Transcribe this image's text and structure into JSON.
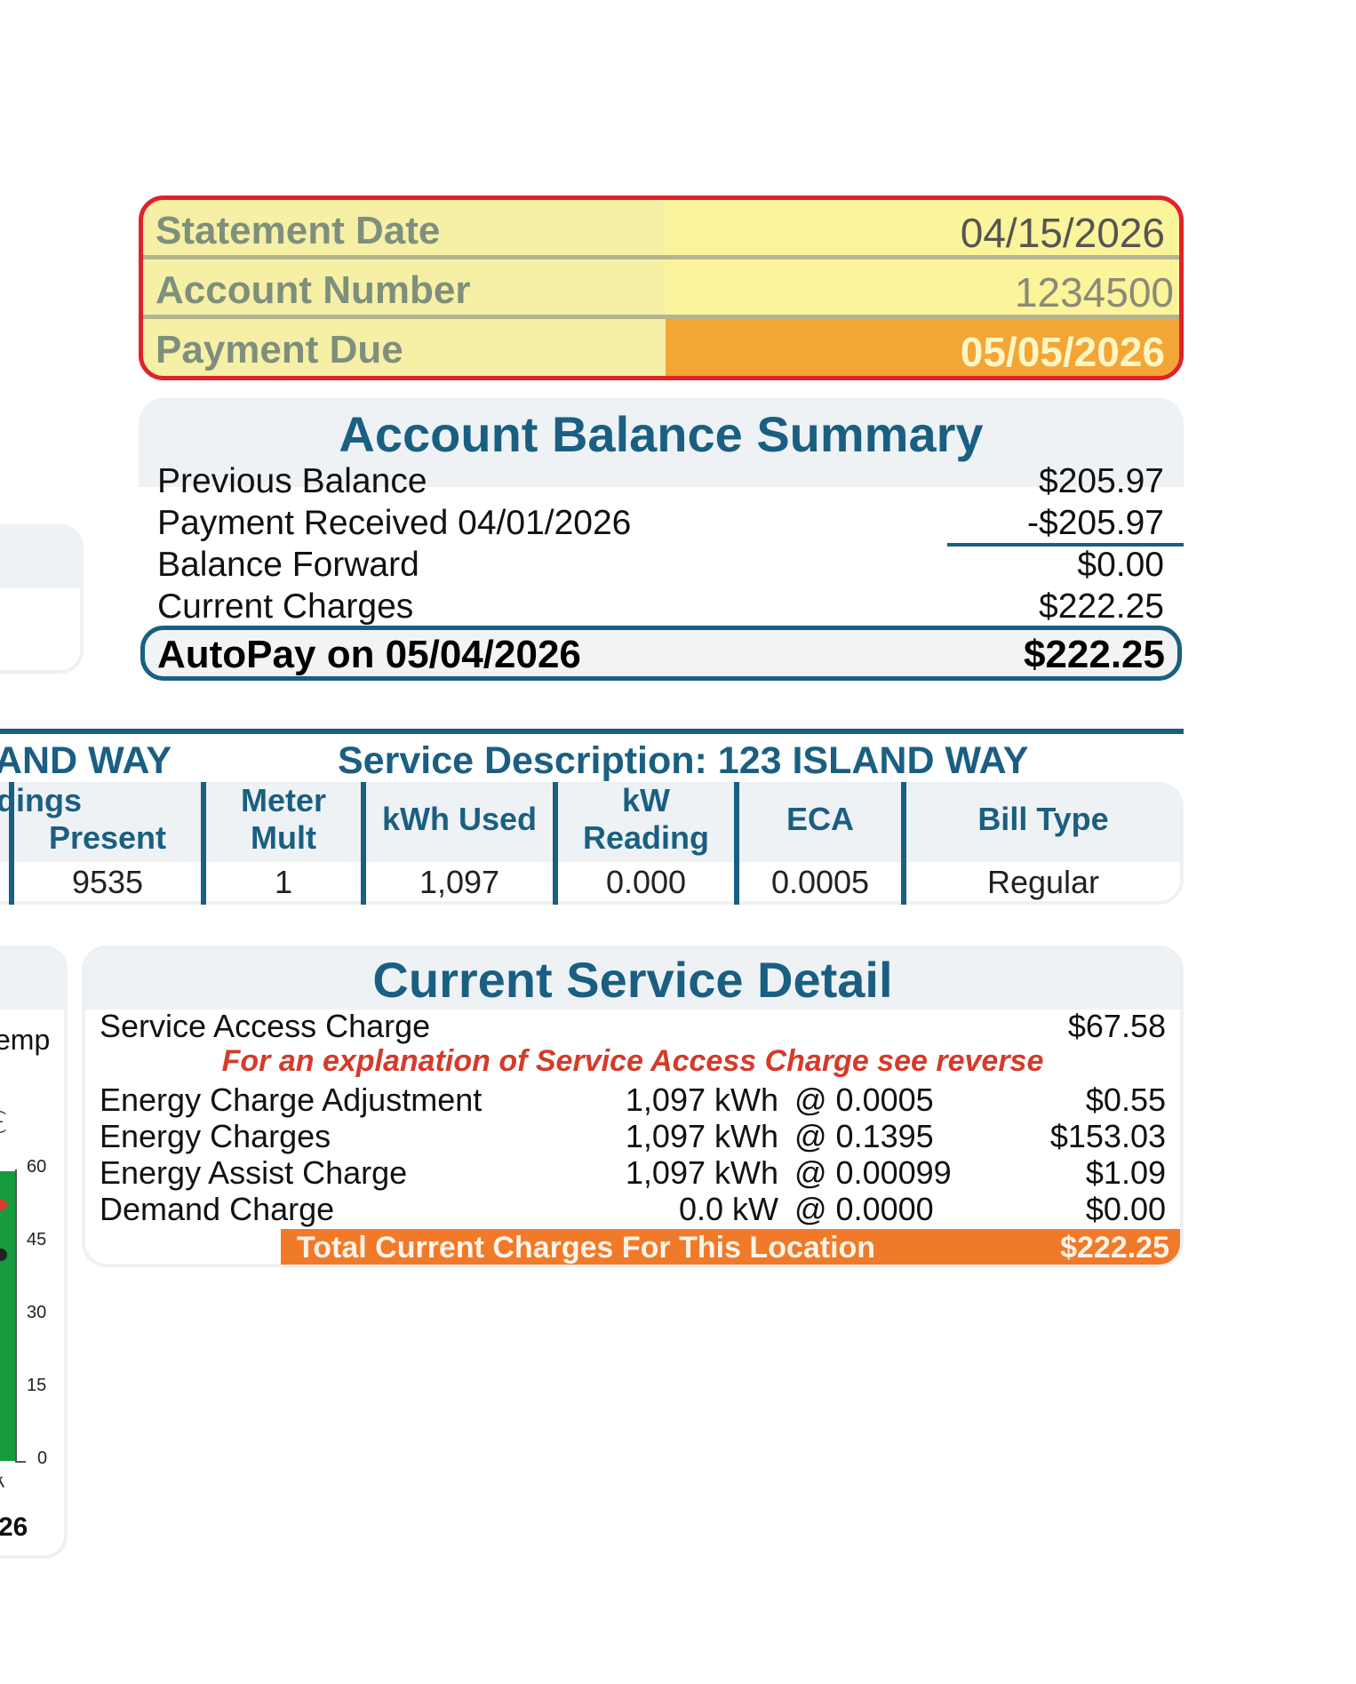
{
  "statement_box": {
    "rows": [
      {
        "label": "Statement Date",
        "value": "04/15/2026"
      },
      {
        "label": "Account Number",
        "value": "1234500"
      },
      {
        "label": "Payment Due",
        "value": "05/05/2026"
      }
    ],
    "colors": {
      "border": "#e0222b",
      "label_bg": "#f5f0a6",
      "due_bg": "#f3a536"
    }
  },
  "balance_summary": {
    "title": "Account Balance Summary",
    "rows": [
      {
        "label": "Previous Balance",
        "value": "$205.97"
      },
      {
        "label": "Payment Received 04/01/2026",
        "value": "-$205.97"
      },
      {
        "label": "Balance Forward",
        "value": "$0.00"
      },
      {
        "label": "Current Charges",
        "value": "$222.25"
      }
    ],
    "autopay": {
      "label": "AutoPay on 05/04/2026",
      "value": "$222.25"
    }
  },
  "service_description": {
    "left_fragment": "AND WAY",
    "title": "Service Description: 123 ISLAND WAY",
    "readings_fragment": "dings",
    "present_label": "Present",
    "columns": [
      "Meter Mult",
      "kWh Used",
      "kW Reading",
      "ECA",
      "Bill Type"
    ],
    "row": {
      "present": "9535",
      "meter_mult": "1",
      "kwh_used": "1,097",
      "kw_reading": "0.000",
      "eca": "0.0005",
      "bill_type": "Regular"
    }
  },
  "usage_chart_fragment": {
    "header_fragment": "emp",
    "axis_label_fragment": "(°F)",
    "y_ticks": [
      "60",
      "45",
      "30",
      "15",
      "0"
    ],
    "year_fragment": "26",
    "x_fragment": "r",
    "bar_color": "#169a3e"
  },
  "service_detail": {
    "title": "Current Service Detail",
    "service_access": {
      "label": "Service Access Charge",
      "value": "$67.58"
    },
    "note": "For an explanation of Service Access Charge see reverse",
    "items": [
      {
        "label": "Energy Charge Adjustment",
        "qty": "1,097 kWh",
        "rate": "@ 0.0005",
        "value": "$0.55"
      },
      {
        "label": "Energy Charges",
        "qty": "1,097 kWh",
        "rate": "@ 0.1395",
        "value": "$153.03"
      },
      {
        "label": "Energy Assist Charge",
        "qty": "1,097 kWh",
        "rate": "@ 0.00099",
        "value": "$1.09"
      },
      {
        "label": "Demand Charge",
        "qty": "0.0 kW",
        "rate": "@ 0.0000",
        "value": "$0.00"
      }
    ],
    "total": {
      "label": "Total Current Charges For This Location",
      "value": "$222.25"
    },
    "colors": {
      "total_bg": "#f07a2a",
      "note": "#d63a2a"
    }
  }
}
